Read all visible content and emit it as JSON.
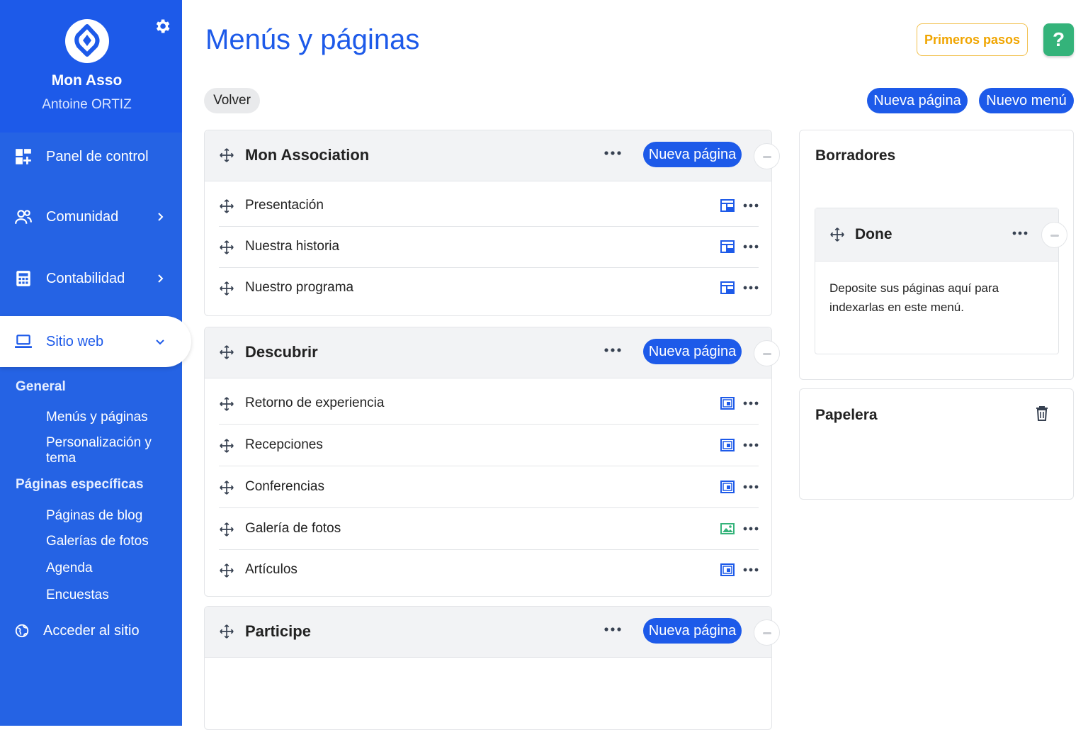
{
  "sidebar": {
    "brand_name": "Mon Asso",
    "user_name": "Antoine ORTIZ",
    "nav": [
      {
        "label": "Panel de control",
        "icon": "dashboard-icon"
      },
      {
        "label": "Comunidad",
        "icon": "users-icon"
      },
      {
        "label": "Contabilidad",
        "icon": "calculator-icon"
      },
      {
        "label": "Sitio web",
        "icon": "laptop-icon",
        "active": true
      }
    ],
    "section_general": "General",
    "general_items": [
      "Menús y páginas",
      "Personalización y tema"
    ],
    "section_specific": "Páginas específicas",
    "specific_items": [
      "Páginas de blog",
      "Galerías de fotos",
      "Agenda",
      "Encuestas"
    ],
    "access_site": "Acceder al sitio"
  },
  "header": {
    "title": "Menús y páginas",
    "first_steps": "Primeros pasos",
    "help": "?",
    "back": "Volver",
    "new_page": "Nueva página",
    "new_menu": "Nuevo menú"
  },
  "menus": [
    {
      "title": "Mon Association",
      "new_page": "Nueva página",
      "pages": [
        {
          "label": "Presentación",
          "icon": "layout-icon"
        },
        {
          "label": "Nuestra historia",
          "icon": "layout-icon"
        },
        {
          "label": "Nuestro programa",
          "icon": "layout-icon"
        }
      ]
    },
    {
      "title": "Descubrir",
      "new_page": "Nueva página",
      "pages": [
        {
          "label": "Retorno de experiencia",
          "icon": "blog-icon"
        },
        {
          "label": "Recepciones",
          "icon": "blog-icon"
        },
        {
          "label": "Conferencias",
          "icon": "blog-icon"
        },
        {
          "label": "Galería de fotos",
          "icon": "image-icon"
        },
        {
          "label": "Artículos",
          "icon": "blog-icon"
        }
      ]
    },
    {
      "title": "Participe",
      "new_page": "Nueva página",
      "pages": []
    }
  ],
  "drafts": {
    "title": "Borradores",
    "menu_title": "Done",
    "hint": "Deposite sus páginas aquí para indexarlas en este menú."
  },
  "trash": {
    "title": "Papelera"
  },
  "colors": {
    "primary": "#1d5ae9",
    "sidebar": "#2563e4",
    "accent_yellow": "#f0a500",
    "help_green": "#34b37a"
  }
}
